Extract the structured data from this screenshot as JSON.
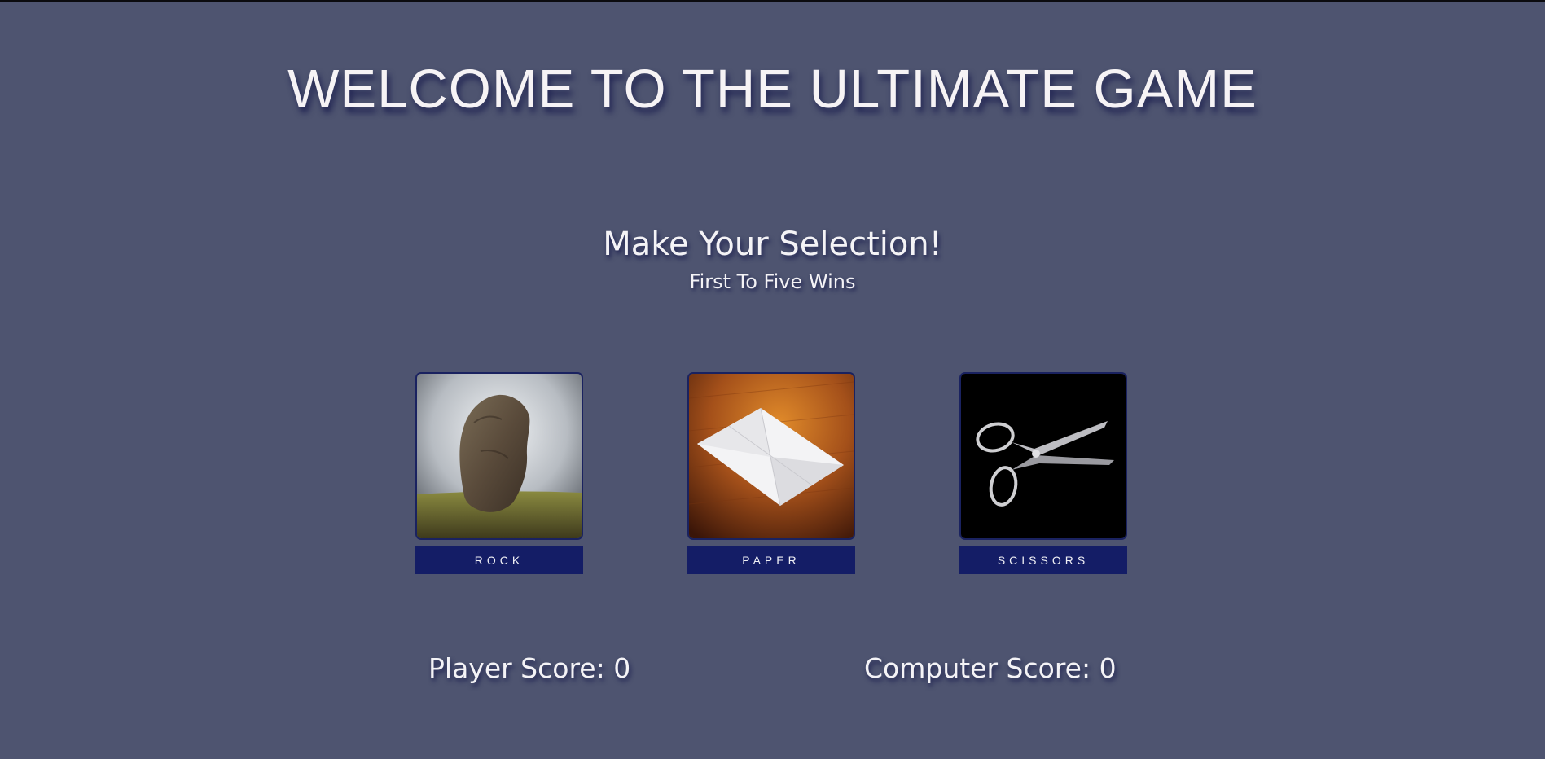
{
  "header": {
    "title": "WELCOME TO THE ULTIMATE GAME"
  },
  "prompt": {
    "heading": "Make Your Selection!",
    "rules": "First To Five Wins"
  },
  "choices": [
    {
      "id": "rock",
      "label": "ROCK",
      "icon": "rock-image"
    },
    {
      "id": "paper",
      "label": "PAPER",
      "icon": "paper-image"
    },
    {
      "id": "scissors",
      "label": "SCISSORS",
      "icon": "scissors-image"
    }
  ],
  "scores": {
    "player_label": "Player Score: ",
    "player_value": "0",
    "computer_label": "Computer Score: ",
    "computer_value": "0"
  },
  "colors": {
    "background": "#4e5470",
    "button": "#141d66",
    "text": "#f4f3f6"
  }
}
